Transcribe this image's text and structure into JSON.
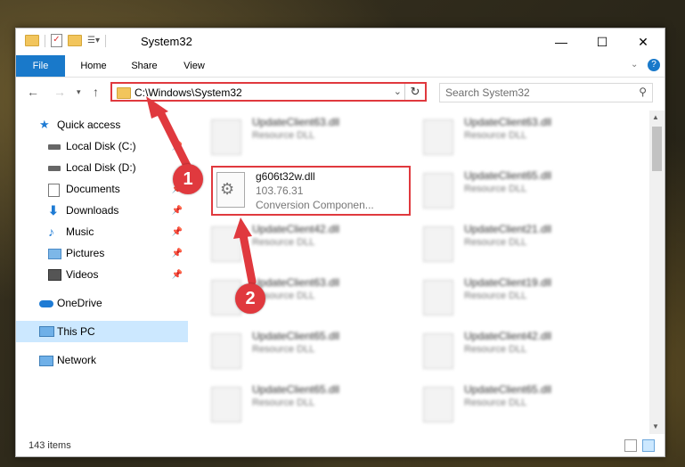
{
  "window": {
    "title": "System32",
    "controls": {
      "minimize": "—",
      "maximize": "☐",
      "close": "✕"
    }
  },
  "ribbon": {
    "tabs": [
      "File",
      "Home",
      "Share",
      "View"
    ]
  },
  "address": {
    "path": "C:\\Windows\\System32",
    "search_placeholder": "Search System32"
  },
  "sidebar": {
    "items": [
      {
        "label": "Quick access",
        "icon": "star-icon"
      },
      {
        "label": "Local Disk (C:)",
        "icon": "drive-icon"
      },
      {
        "label": "Local Disk (D:)",
        "icon": "drive-icon"
      },
      {
        "label": "Documents",
        "icon": "document-icon"
      },
      {
        "label": "Downloads",
        "icon": "download-icon"
      },
      {
        "label": "Music",
        "icon": "music-icon"
      },
      {
        "label": "Pictures",
        "icon": "pictures-icon"
      },
      {
        "label": "Videos",
        "icon": "video-icon"
      },
      {
        "label": "OneDrive",
        "icon": "cloud-icon"
      },
      {
        "label": "This PC",
        "icon": "computer-icon"
      },
      {
        "label": "Network",
        "icon": "network-icon"
      }
    ]
  },
  "files": {
    "left_column": [
      {
        "name": "UpdateClient63.dll",
        "desc": "Resource DLL"
      },
      {
        "name": "UpdateClient42.dll",
        "desc": "Resource DLL"
      },
      {
        "name": "UpdateClient63.dll",
        "desc": "Resource DLL"
      },
      {
        "name": "UpdateClient65.dll",
        "desc": "Resource DLL"
      },
      {
        "name": "UpdateClient65.dll",
        "desc": "Resource DLL"
      }
    ],
    "right_column": [
      {
        "name": "UpdateClient63.dll",
        "desc": "Resource DLL"
      },
      {
        "name": "UpdateClient65.dll",
        "desc": "Resource DLL"
      },
      {
        "name": "UpdateClient21.dll",
        "desc": "Resource DLL"
      },
      {
        "name": "UpdateClient19.dll",
        "desc": "Resource DLL"
      },
      {
        "name": "UpdateClient42.dll",
        "desc": "Resource DLL"
      },
      {
        "name": "UpdateClient65.dll",
        "desc": "Resource DLL"
      }
    ],
    "selected": {
      "name": "g606t32w.dll",
      "version": "103.76.31",
      "description": "Conversion Componen..."
    }
  },
  "status": {
    "item_count": "143 items"
  },
  "annotations": {
    "step1": "1",
    "step2": "2",
    "color": "#e0393e"
  }
}
